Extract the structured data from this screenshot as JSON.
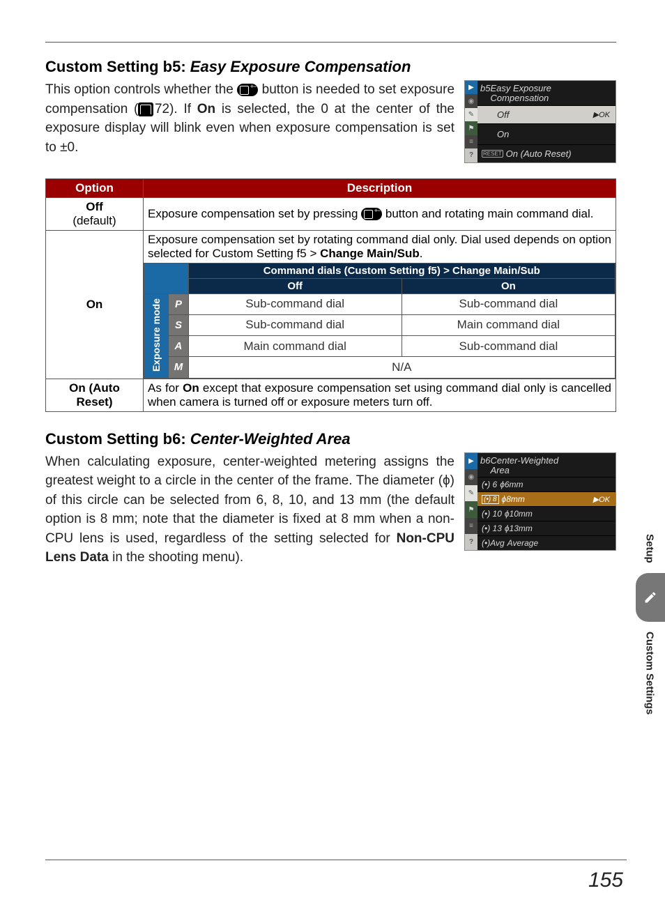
{
  "sectionB5": {
    "title_prefix": "Custom Setting b5: ",
    "title_italic": "Easy Exposure Compensation",
    "para_before_icon": "This option controls whether the ",
    "para_after_icon_1": " button is needed to set exposure compensation (",
    "page_ref": "72",
    "para_after_icon_2": ").  If ",
    "bold_on": "On",
    "para_tail": " is selected, the 0 at the center of the exposure display will blink even when exposure compensation is set to ±0."
  },
  "camMenuB5": {
    "title_code": "b5",
    "title_line1": "Easy Exposure",
    "title_line2": "Compensation",
    "rows": [
      {
        "label": "Off",
        "right": "▶OK",
        "highlight": true
      },
      {
        "label": "On"
      },
      {
        "reset": "RESET",
        "label": "On (Auto Reset)"
      }
    ]
  },
  "table": {
    "head_option": "Option",
    "head_desc": "Description",
    "off": {
      "main": "Off",
      "sub": "(default)",
      "desc_before": "Exposure compensation set by pressing ",
      "desc_after": " button and rotating main command dial."
    },
    "on": {
      "main": "On",
      "lead_text": "Exposure compensation set by rotating command dial only.  Dial used depends on option selected for Custom Setting f5 > ",
      "lead_bold": "Change Main/Sub",
      "lead_tail": ".",
      "inner_head": "Command dials (Custom Setting f5) > Change Main/Sub",
      "col_off": "Off",
      "col_on": "On",
      "vert": "Exposure mode",
      "modes": [
        "P",
        "S",
        "A",
        "M"
      ],
      "cells": [
        [
          "Sub-command dial",
          "Sub-command dial"
        ],
        [
          "Sub-command dial",
          "Main command dial"
        ],
        [
          "Main command dial",
          "Sub-command dial"
        ]
      ],
      "na": "N/A"
    },
    "onAuto": {
      "main": "On (Auto Reset)",
      "desc_before": "As for ",
      "desc_bold": "On",
      "desc_after": " except that exposure compensation set using command dial only is cancelled when camera is turned off or exposure meters turn off."
    }
  },
  "sectionB6": {
    "title_prefix": "Custom Setting b6: ",
    "title_italic": "Center-Weighted Area",
    "para_before_bold": "When calculating exposure, center-weighted metering assigns the greatest weight to a circle in the center of the frame.  The diameter (ϕ) of this circle can be selected from 6, 8, 10, and 13 mm (the default option is 8 mm; note that the diameter is fixed at 8 mm when a non-CPU lens is used, regardless of the setting selected for ",
    "bold": "Non-CPU Lens Data",
    "para_after_bold": " in the shooting menu)."
  },
  "camMenuB6": {
    "title_code": "b6",
    "title_line1": "Center-Weighted",
    "title_line2": "Area",
    "rows": [
      {
        "pre": "(•) 6",
        "label": "ϕ6mm"
      },
      {
        "pre": "(•) 8",
        "label": "ϕ8mm",
        "right": "▶OK",
        "highlight": true
      },
      {
        "pre": "(•) 10",
        "label": "ϕ10mm"
      },
      {
        "pre": "(•) 13",
        "label": "ϕ13mm"
      },
      {
        "pre": "(•)Avg",
        "label": "Average"
      }
    ]
  },
  "sideTab": {
    "top": "Setup",
    "bottom": "Custom Settings"
  },
  "pageNumber": "155"
}
